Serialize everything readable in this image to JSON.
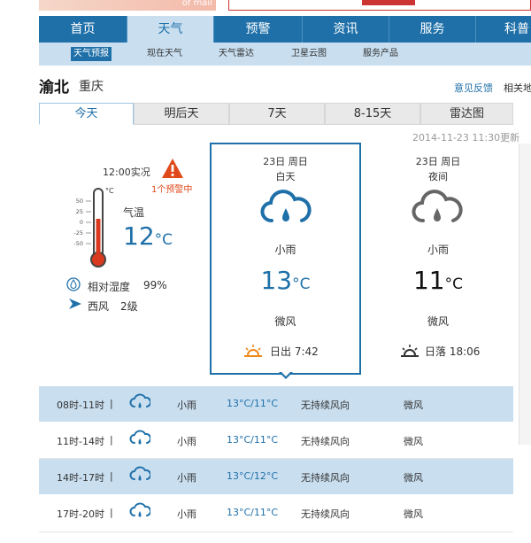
{
  "banner": {
    "ad_text": "of mail"
  },
  "nav": {
    "items": [
      {
        "label": "首页",
        "active": false
      },
      {
        "label": "天气",
        "active": true
      },
      {
        "label": "预警",
        "active": false
      },
      {
        "label": "资讯",
        "active": false
      },
      {
        "label": "服务",
        "active": false
      },
      {
        "label": "科普",
        "active": false
      }
    ]
  },
  "subnav": {
    "items": [
      {
        "label": "天气预报",
        "active": true
      },
      {
        "label": "现在天气",
        "active": false
      },
      {
        "label": "天气雷达",
        "active": false
      },
      {
        "label": "卫星云图",
        "active": false
      },
      {
        "label": "服务产品",
        "active": false
      }
    ]
  },
  "location": {
    "district": "渝北",
    "city": "重庆"
  },
  "links": {
    "feedback": "意见反馈",
    "related": "相关地"
  },
  "tabs": [
    {
      "label": "今天",
      "active": true
    },
    {
      "label": "明后天",
      "active": false
    },
    {
      "label": "7天",
      "active": false
    },
    {
      "label": "8-15天",
      "active": false
    },
    {
      "label": "雷达图",
      "active": false
    }
  ],
  "updated": "2014-11-23 11:30更新",
  "current": {
    "time_label": "12:00实况",
    "warning_text": "1个预警中",
    "temp_label": "气温",
    "temp_value": "12",
    "temp_unit": "°C",
    "thermo_scale": [
      "50",
      "25",
      "0",
      "-25",
      "-50"
    ],
    "thermo_unit": "°C",
    "humidity_label": "相对湿度",
    "humidity_value": "99%",
    "wind_dir": "西风",
    "wind_level": "2级"
  },
  "day": {
    "date": "23日 周日",
    "part": "白天",
    "condition": "小雨",
    "temp": "13",
    "temp_unit": "°C",
    "wind": "微风",
    "sun_label": "日出 7:42",
    "icon": "cloud-rain-icon",
    "accent": "#1f70a9"
  },
  "night": {
    "date": "23日 周日",
    "part": "夜间",
    "condition": "小雨",
    "temp": "11",
    "temp_unit": "°C",
    "wind": "微风",
    "sun_label": "日落 18:06",
    "icon": "cloud-rain-icon"
  },
  "hourly": [
    {
      "time": "08时-11时",
      "sep": "|",
      "cond": "小雨",
      "temp": "13°C/11°C",
      "wind_dir": "无持续风向",
      "wind_lvl": "微风",
      "shaded": true
    },
    {
      "time": "11时-14时",
      "sep": "|",
      "cond": "小雨",
      "temp": "13°C/11°C",
      "wind_dir": "无持续风向",
      "wind_lvl": "微风",
      "shaded": false
    },
    {
      "time": "14时-17时",
      "sep": "|",
      "cond": "小雨",
      "temp": "13°C/12°C",
      "wind_dir": "无持续风向",
      "wind_lvl": "微风",
      "shaded": true
    },
    {
      "time": "17时-20时",
      "sep": "|",
      "cond": "小雨",
      "temp": "13°C/11°C",
      "wind_dir": "无持续风向",
      "wind_lvl": "微风",
      "shaded": false
    }
  ],
  "colors": {
    "brand_blue": "#1f70a9",
    "nav_light": "#c9dff0",
    "warning": "#e04a1a",
    "thermo_red": "#d9391e"
  }
}
